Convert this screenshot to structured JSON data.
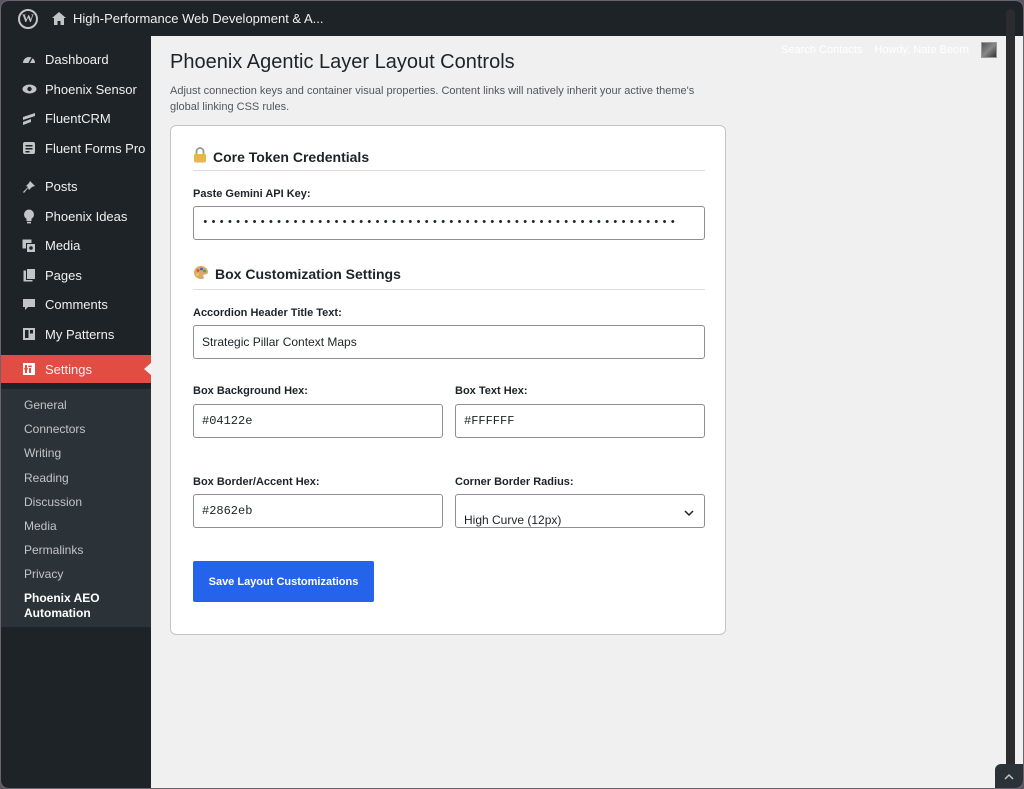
{
  "adminbar": {
    "site_title": "High-Performance Web Development & A..."
  },
  "sidebar": {
    "items": [
      {
        "label": "Dashboard",
        "icon": "dashboard-icon"
      },
      {
        "label": "Phoenix Sensor",
        "icon": "eye-icon"
      },
      {
        "label": "FluentCRM",
        "icon": "fluentcrm-icon"
      },
      {
        "label": "Fluent Forms Pro",
        "icon": "forms-icon"
      },
      {
        "label": "Posts",
        "icon": "pin-icon"
      },
      {
        "label": "Phoenix Ideas",
        "icon": "lightbulb-icon"
      },
      {
        "label": "Media",
        "icon": "media-icon"
      },
      {
        "label": "Pages",
        "icon": "pages-icon"
      },
      {
        "label": "Comments",
        "icon": "comment-icon"
      },
      {
        "label": "My Patterns",
        "icon": "patterns-icon"
      },
      {
        "label": "Settings",
        "icon": "settings-icon"
      }
    ],
    "submenu": [
      "General",
      "Connectors",
      "Writing",
      "Reading",
      "Discussion",
      "Media",
      "Permalinks",
      "Privacy"
    ],
    "current": "Phoenix AEO Automation",
    "accent": "#e14d43"
  },
  "topright": {
    "search_label": "Search Contacts",
    "greeting": "Howdy, Nate Beorn"
  },
  "main": {
    "title": "Phoenix Agentic Layer Layout Controls",
    "description": "Adjust connection keys and container visual properties. Content links will natively inherit your active theme's global linking CSS rules."
  },
  "card": {
    "credentials": {
      "title": "Core Token Credentials",
      "api_key_label": "Paste Gemini API Key:",
      "api_key_value": "••••••••••••••••••••••••••••••••••••••••••••••••••••••••••"
    },
    "customization": {
      "title": "Box Customization Settings",
      "header_label": "Accordion Header Title Text:",
      "header_value": "Strategic Pillar Context Maps",
      "bg_label": "Box Background Hex:",
      "bg_value": "#04122e",
      "text_label": "Box Text Hex:",
      "text_value": "#FFFFFF",
      "border_label": "Box Border/Accent Hex:",
      "border_value": "#2862eb",
      "radius_label": "Corner Border Radius:",
      "radius_value": "High Curve (12px)"
    },
    "save_label": "Save Layout Customizations",
    "button_color": "#2563eb"
  }
}
